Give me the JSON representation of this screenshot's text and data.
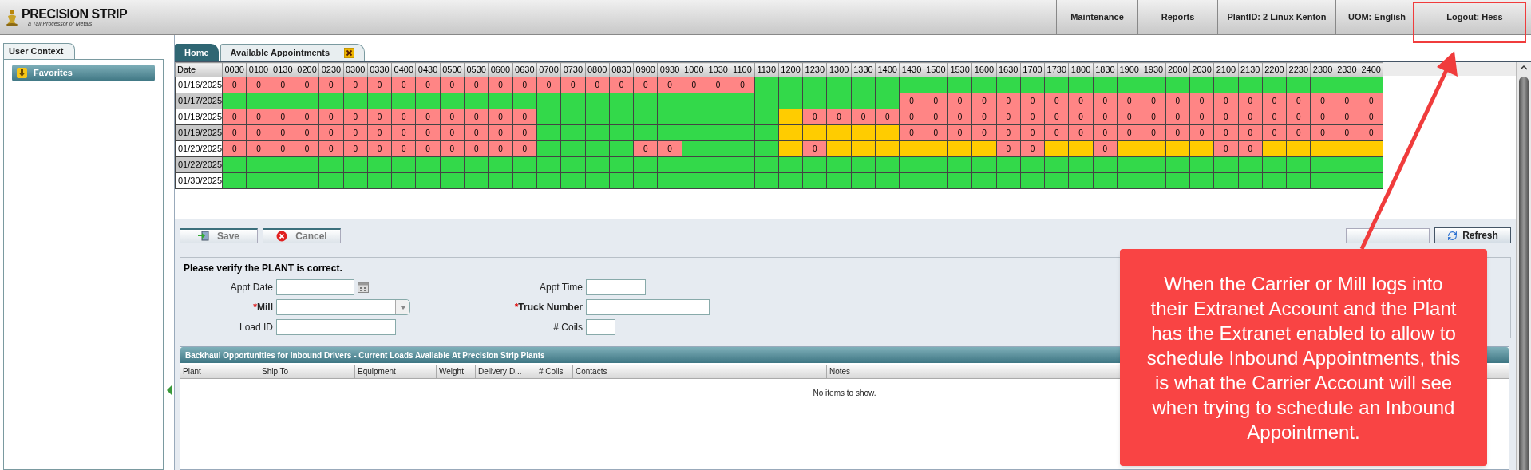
{
  "header": {
    "logo": {
      "title": "PRECISION STRIP",
      "tagline": "a Tall Processor of Metals"
    },
    "menu": [
      {
        "label": "Maintenance"
      },
      {
        "label": "Reports"
      },
      {
        "label": "PlantID: 2 Linux Kenton"
      },
      {
        "label": "UOM: English"
      },
      {
        "label": "Logout: Hess"
      }
    ]
  },
  "sidebar": {
    "tab": "User Context",
    "favorites": "Favorites"
  },
  "tabs": [
    {
      "label": "Home",
      "selected": false,
      "closable": false
    },
    {
      "label": "Available Appointments",
      "selected": true,
      "closable": true
    }
  ],
  "grid": {
    "date_header": "Date",
    "times": [
      "0030",
      "0100",
      "0130",
      "0200",
      "0230",
      "0300",
      "0330",
      "0400",
      "0430",
      "0500",
      "0530",
      "0600",
      "0630",
      "0700",
      "0730",
      "0800",
      "0830",
      "0900",
      "0930",
      "1000",
      "1030",
      "1100",
      "1130",
      "1200",
      "1230",
      "1300",
      "1330",
      "1400",
      "1430",
      "1500",
      "1530",
      "1600",
      "1630",
      "1700",
      "1730",
      "1800",
      "1830",
      "1900",
      "1930",
      "2000",
      "2030",
      "2100",
      "2130",
      "2200",
      "2230",
      "2300",
      "2330",
      "2400"
    ],
    "rows": [
      {
        "date": "01/16/2025",
        "slots": [
          {
            "color": "#ff8585",
            "count": "0"
          },
          {
            "color": "#ff8585",
            "count": "0"
          },
          {
            "color": "#ff8585",
            "count": "0"
          },
          {
            "color": "#ff8585",
            "count": "0"
          },
          {
            "color": "#ff8585",
            "count": "0"
          },
          {
            "color": "#ff8585",
            "count": "0"
          },
          {
            "color": "#ff8585",
            "count": "0"
          },
          {
            "color": "#ff8585",
            "count": "0"
          },
          {
            "color": "#ff8585",
            "count": "0"
          },
          {
            "color": "#ff8585",
            "count": "0"
          },
          {
            "color": "#ff8585",
            "count": "0"
          },
          {
            "color": "#ff8585",
            "count": "0"
          },
          {
            "color": "#ff8585",
            "count": "0"
          },
          {
            "color": "#ff8585",
            "count": "0"
          },
          {
            "color": "#ff8585",
            "count": "0"
          },
          {
            "color": "#ff8585",
            "count": "0"
          },
          {
            "color": "#ff8585",
            "count": "0"
          },
          {
            "color": "#ff8585",
            "count": "0"
          },
          {
            "color": "#ff8585",
            "count": "0"
          },
          {
            "color": "#ff8585",
            "count": "0"
          },
          {
            "color": "#ff8585",
            "count": "0"
          },
          {
            "color": "#ff8585",
            "count": "0"
          },
          {
            "color": "#33d94a"
          },
          {
            "color": "#33d94a"
          },
          {
            "color": "#33d94a"
          },
          {
            "color": "#33d94a"
          },
          {
            "color": "#33d94a"
          },
          {
            "color": "#33d94a"
          },
          {
            "color": "#33d94a"
          },
          {
            "color": "#33d94a"
          },
          {
            "color": "#33d94a"
          },
          {
            "color": "#33d94a"
          },
          {
            "color": "#33d94a"
          },
          {
            "color": "#33d94a"
          },
          {
            "color": "#33d94a"
          },
          {
            "color": "#33d94a"
          },
          {
            "color": "#33d94a"
          },
          {
            "color": "#33d94a"
          },
          {
            "color": "#33d94a"
          },
          {
            "color": "#33d94a"
          },
          {
            "color": "#33d94a"
          },
          {
            "color": "#33d94a"
          },
          {
            "color": "#33d94a"
          },
          {
            "color": "#33d94a"
          },
          {
            "color": "#33d94a"
          },
          {
            "color": "#33d94a"
          },
          {
            "color": "#33d94a"
          },
          {
            "color": "#33d94a"
          }
        ]
      },
      {
        "date": "01/17/2025",
        "slots": [
          {
            "color": "#33d94a"
          },
          {
            "color": "#33d94a"
          },
          {
            "color": "#33d94a"
          },
          {
            "color": "#33d94a"
          },
          {
            "color": "#33d94a"
          },
          {
            "color": "#33d94a"
          },
          {
            "color": "#33d94a"
          },
          {
            "color": "#33d94a"
          },
          {
            "color": "#33d94a"
          },
          {
            "color": "#33d94a"
          },
          {
            "color": "#33d94a"
          },
          {
            "color": "#33d94a"
          },
          {
            "color": "#33d94a"
          },
          {
            "color": "#33d94a"
          },
          {
            "color": "#33d94a"
          },
          {
            "color": "#33d94a"
          },
          {
            "color": "#33d94a"
          },
          {
            "color": "#33d94a"
          },
          {
            "color": "#33d94a"
          },
          {
            "color": "#33d94a"
          },
          {
            "color": "#33d94a"
          },
          {
            "color": "#33d94a"
          },
          {
            "color": "#33d94a"
          },
          {
            "color": "#33d94a"
          },
          {
            "color": "#33d94a"
          },
          {
            "color": "#33d94a"
          },
          {
            "color": "#33d94a"
          },
          {
            "color": "#33d94a"
          },
          {
            "color": "#ff8585",
            "count": "0"
          },
          {
            "color": "#ff8585",
            "count": "0"
          },
          {
            "color": "#ff8585",
            "count": "0"
          },
          {
            "color": "#ff8585",
            "count": "0"
          },
          {
            "color": "#ff8585",
            "count": "0"
          },
          {
            "color": "#ff8585",
            "count": "0"
          },
          {
            "color": "#ff8585",
            "count": "0"
          },
          {
            "color": "#ff8585",
            "count": "0"
          },
          {
            "color": "#ff8585",
            "count": "0"
          },
          {
            "color": "#ff8585",
            "count": "0"
          },
          {
            "color": "#ff8585",
            "count": "0"
          },
          {
            "color": "#ff8585",
            "count": "0"
          },
          {
            "color": "#ff8585",
            "count": "0"
          },
          {
            "color": "#ff8585",
            "count": "0"
          },
          {
            "color": "#ff8585",
            "count": "0"
          },
          {
            "color": "#ff8585",
            "count": "0"
          },
          {
            "color": "#ff8585",
            "count": "0"
          },
          {
            "color": "#ff8585",
            "count": "0"
          },
          {
            "color": "#ff8585",
            "count": "0"
          },
          {
            "color": "#ff8585",
            "count": "0"
          }
        ]
      },
      {
        "date": "01/18/2025",
        "slots": [
          {
            "color": "#ff8585",
            "count": "0"
          },
          {
            "color": "#ff8585",
            "count": "0"
          },
          {
            "color": "#ff8585",
            "count": "0"
          },
          {
            "color": "#ff8585",
            "count": "0"
          },
          {
            "color": "#ff8585",
            "count": "0"
          },
          {
            "color": "#ff8585",
            "count": "0"
          },
          {
            "color": "#ff8585",
            "count": "0"
          },
          {
            "color": "#ff8585",
            "count": "0"
          },
          {
            "color": "#ff8585",
            "count": "0"
          },
          {
            "color": "#ff8585",
            "count": "0"
          },
          {
            "color": "#ff8585",
            "count": "0"
          },
          {
            "color": "#ff8585",
            "count": "0"
          },
          {
            "color": "#ff8585",
            "count": "0"
          },
          {
            "color": "#33d94a"
          },
          {
            "color": "#33d94a"
          },
          {
            "color": "#33d94a"
          },
          {
            "color": "#33d94a"
          },
          {
            "color": "#33d94a"
          },
          {
            "color": "#33d94a"
          },
          {
            "color": "#33d94a"
          },
          {
            "color": "#33d94a"
          },
          {
            "color": "#33d94a"
          },
          {
            "color": "#33d94a"
          },
          {
            "color": "#ffcc00"
          },
          {
            "color": "#ff8585",
            "count": "0"
          },
          {
            "color": "#ff8585",
            "count": "0"
          },
          {
            "color": "#ff8585",
            "count": "0"
          },
          {
            "color": "#ff8585",
            "count": "0"
          },
          {
            "color": "#ff8585",
            "count": "0"
          },
          {
            "color": "#ff8585",
            "count": "0"
          },
          {
            "color": "#ff8585",
            "count": "0"
          },
          {
            "color": "#ff8585",
            "count": "0"
          },
          {
            "color": "#ff8585",
            "count": "0"
          },
          {
            "color": "#ff8585",
            "count": "0"
          },
          {
            "color": "#ff8585",
            "count": "0"
          },
          {
            "color": "#ff8585",
            "count": "0"
          },
          {
            "color": "#ff8585",
            "count": "0"
          },
          {
            "color": "#ff8585",
            "count": "0"
          },
          {
            "color": "#ff8585",
            "count": "0"
          },
          {
            "color": "#ff8585",
            "count": "0"
          },
          {
            "color": "#ff8585",
            "count": "0"
          },
          {
            "color": "#ff8585",
            "count": "0"
          },
          {
            "color": "#ff8585",
            "count": "0"
          },
          {
            "color": "#ff8585",
            "count": "0"
          },
          {
            "color": "#ff8585",
            "count": "0"
          },
          {
            "color": "#ff8585",
            "count": "0"
          },
          {
            "color": "#ff8585",
            "count": "0"
          },
          {
            "color": "#ff8585",
            "count": "0"
          }
        ]
      },
      {
        "date": "01/19/2025",
        "slots": [
          {
            "color": "#ff8585",
            "count": "0"
          },
          {
            "color": "#ff8585",
            "count": "0"
          },
          {
            "color": "#ff8585",
            "count": "0"
          },
          {
            "color": "#ff8585",
            "count": "0"
          },
          {
            "color": "#ff8585",
            "count": "0"
          },
          {
            "color": "#ff8585",
            "count": "0"
          },
          {
            "color": "#ff8585",
            "count": "0"
          },
          {
            "color": "#ff8585",
            "count": "0"
          },
          {
            "color": "#ff8585",
            "count": "0"
          },
          {
            "color": "#ff8585",
            "count": "0"
          },
          {
            "color": "#ff8585",
            "count": "0"
          },
          {
            "color": "#ff8585",
            "count": "0"
          },
          {
            "color": "#ff8585",
            "count": "0"
          },
          {
            "color": "#33d94a"
          },
          {
            "color": "#33d94a"
          },
          {
            "color": "#33d94a"
          },
          {
            "color": "#33d94a"
          },
          {
            "color": "#33d94a"
          },
          {
            "color": "#33d94a"
          },
          {
            "color": "#33d94a"
          },
          {
            "color": "#33d94a"
          },
          {
            "color": "#33d94a"
          },
          {
            "color": "#33d94a"
          },
          {
            "color": "#ffcc00"
          },
          {
            "color": "#ffcc00"
          },
          {
            "color": "#ffcc00"
          },
          {
            "color": "#ffcc00"
          },
          {
            "color": "#ffcc00"
          },
          {
            "color": "#ff8585",
            "count": "0"
          },
          {
            "color": "#ff8585",
            "count": "0"
          },
          {
            "color": "#ff8585",
            "count": "0"
          },
          {
            "color": "#ff8585",
            "count": "0"
          },
          {
            "color": "#ff8585",
            "count": "0"
          },
          {
            "color": "#ff8585",
            "count": "0"
          },
          {
            "color": "#ff8585",
            "count": "0"
          },
          {
            "color": "#ff8585",
            "count": "0"
          },
          {
            "color": "#ff8585",
            "count": "0"
          },
          {
            "color": "#ff8585",
            "count": "0"
          },
          {
            "color": "#ff8585",
            "count": "0"
          },
          {
            "color": "#ff8585",
            "count": "0"
          },
          {
            "color": "#ff8585",
            "count": "0"
          },
          {
            "color": "#ff8585",
            "count": "0"
          },
          {
            "color": "#ff8585",
            "count": "0"
          },
          {
            "color": "#ff8585",
            "count": "0"
          },
          {
            "color": "#ff8585",
            "count": "0"
          },
          {
            "color": "#ff8585",
            "count": "0"
          },
          {
            "color": "#ff8585",
            "count": "0"
          },
          {
            "color": "#ff8585",
            "count": "0"
          }
        ]
      },
      {
        "date": "01/20/2025",
        "slots": [
          {
            "color": "#ff8585",
            "count": "0"
          },
          {
            "color": "#ff8585",
            "count": "0"
          },
          {
            "color": "#ff8585",
            "count": "0"
          },
          {
            "color": "#ff8585",
            "count": "0"
          },
          {
            "color": "#ff8585",
            "count": "0"
          },
          {
            "color": "#ff8585",
            "count": "0"
          },
          {
            "color": "#ff8585",
            "count": "0"
          },
          {
            "color": "#ff8585",
            "count": "0"
          },
          {
            "color": "#ff8585",
            "count": "0"
          },
          {
            "color": "#ff8585",
            "count": "0"
          },
          {
            "color": "#ff8585",
            "count": "0"
          },
          {
            "color": "#ff8585",
            "count": "0"
          },
          {
            "color": "#ff8585",
            "count": "0"
          },
          {
            "color": "#33d94a"
          },
          {
            "color": "#33d94a"
          },
          {
            "color": "#33d94a"
          },
          {
            "color": "#33d94a"
          },
          {
            "color": "#ff8585",
            "count": "0"
          },
          {
            "color": "#ff8585",
            "count": "0"
          },
          {
            "color": "#33d94a"
          },
          {
            "color": "#33d94a"
          },
          {
            "color": "#33d94a"
          },
          {
            "color": "#33d94a"
          },
          {
            "color": "#ffcc00"
          },
          {
            "color": "#ff8585",
            "count": "0"
          },
          {
            "color": "#ffcc00"
          },
          {
            "color": "#ffcc00"
          },
          {
            "color": "#ffcc00"
          },
          {
            "color": "#ffcc00"
          },
          {
            "color": "#ffcc00"
          },
          {
            "color": "#ffcc00"
          },
          {
            "color": "#ffcc00"
          },
          {
            "color": "#ff8585",
            "count": "0"
          },
          {
            "color": "#ff8585",
            "count": "0"
          },
          {
            "color": "#ffcc00"
          },
          {
            "color": "#ffcc00"
          },
          {
            "color": "#ff8585",
            "count": "0"
          },
          {
            "color": "#ffcc00"
          },
          {
            "color": "#ffcc00"
          },
          {
            "color": "#ffcc00"
          },
          {
            "color": "#ffcc00"
          },
          {
            "color": "#ff8585",
            "count": "0"
          },
          {
            "color": "#ff8585",
            "count": "0"
          },
          {
            "color": "#ffcc00"
          },
          {
            "color": "#ffcc00"
          },
          {
            "color": "#ffcc00"
          },
          {
            "color": "#ffcc00"
          },
          {
            "color": "#ffcc00"
          }
        ]
      },
      {
        "date": "01/22/2025",
        "slots": [
          {
            "color": "#33d94a"
          },
          {
            "color": "#33d94a"
          },
          {
            "color": "#33d94a"
          },
          {
            "color": "#33d94a"
          },
          {
            "color": "#33d94a"
          },
          {
            "color": "#33d94a"
          },
          {
            "color": "#33d94a"
          },
          {
            "color": "#33d94a"
          },
          {
            "color": "#33d94a"
          },
          {
            "color": "#33d94a"
          },
          {
            "color": "#33d94a"
          },
          {
            "color": "#33d94a"
          },
          {
            "color": "#33d94a"
          },
          {
            "color": "#33d94a"
          },
          {
            "color": "#33d94a"
          },
          {
            "color": "#33d94a"
          },
          {
            "color": "#33d94a"
          },
          {
            "color": "#33d94a"
          },
          {
            "color": "#33d94a"
          },
          {
            "color": "#33d94a"
          },
          {
            "color": "#33d94a"
          },
          {
            "color": "#33d94a"
          },
          {
            "color": "#33d94a"
          },
          {
            "color": "#33d94a"
          },
          {
            "color": "#33d94a"
          },
          {
            "color": "#33d94a"
          },
          {
            "color": "#33d94a"
          },
          {
            "color": "#33d94a"
          },
          {
            "color": "#33d94a"
          },
          {
            "color": "#33d94a"
          },
          {
            "color": "#33d94a"
          },
          {
            "color": "#33d94a"
          },
          {
            "color": "#33d94a"
          },
          {
            "color": "#33d94a"
          },
          {
            "color": "#33d94a"
          },
          {
            "color": "#33d94a"
          },
          {
            "color": "#33d94a"
          },
          {
            "color": "#33d94a"
          },
          {
            "color": "#33d94a"
          },
          {
            "color": "#33d94a"
          },
          {
            "color": "#33d94a"
          },
          {
            "color": "#33d94a"
          },
          {
            "color": "#33d94a"
          },
          {
            "color": "#33d94a"
          },
          {
            "color": "#33d94a"
          },
          {
            "color": "#33d94a"
          },
          {
            "color": "#33d94a"
          },
          {
            "color": "#33d94a"
          }
        ]
      },
      {
        "date": "01/30/2025",
        "slots": [
          {
            "color": "#33d94a"
          },
          {
            "color": "#33d94a"
          },
          {
            "color": "#33d94a"
          },
          {
            "color": "#33d94a"
          },
          {
            "color": "#33d94a"
          },
          {
            "color": "#33d94a"
          },
          {
            "color": "#33d94a"
          },
          {
            "color": "#33d94a"
          },
          {
            "color": "#33d94a"
          },
          {
            "color": "#33d94a"
          },
          {
            "color": "#33d94a"
          },
          {
            "color": "#33d94a"
          },
          {
            "color": "#33d94a"
          },
          {
            "color": "#33d94a"
          },
          {
            "color": "#33d94a"
          },
          {
            "color": "#33d94a"
          },
          {
            "color": "#33d94a"
          },
          {
            "color": "#33d94a"
          },
          {
            "color": "#33d94a"
          },
          {
            "color": "#33d94a"
          },
          {
            "color": "#33d94a"
          },
          {
            "color": "#33d94a"
          },
          {
            "color": "#33d94a"
          },
          {
            "color": "#33d94a"
          },
          {
            "color": "#33d94a"
          },
          {
            "color": "#33d94a"
          },
          {
            "color": "#33d94a"
          },
          {
            "color": "#33d94a"
          },
          {
            "color": "#33d94a"
          },
          {
            "color": "#33d94a"
          },
          {
            "color": "#33d94a"
          },
          {
            "color": "#33d94a"
          },
          {
            "color": "#33d94a"
          },
          {
            "color": "#33d94a"
          },
          {
            "color": "#33d94a"
          },
          {
            "color": "#33d94a"
          },
          {
            "color": "#33d94a"
          },
          {
            "color": "#33d94a"
          },
          {
            "color": "#33d94a"
          },
          {
            "color": "#33d94a"
          },
          {
            "color": "#33d94a"
          },
          {
            "color": "#33d94a"
          },
          {
            "color": "#33d94a"
          },
          {
            "color": "#33d94a"
          },
          {
            "color": "#33d94a"
          },
          {
            "color": "#33d94a"
          },
          {
            "color": "#33d94a"
          },
          {
            "color": "#33d94a"
          }
        ]
      }
    ]
  },
  "toolbar": {
    "buttons": [
      {
        "label": "Save",
        "kind": "save"
      },
      {
        "label": "Cancel",
        "kind": "cancel"
      }
    ],
    "refresh": "Refresh"
  },
  "form": {
    "notice": "Please verify the PLANT is correct.",
    "fields": [
      {
        "label": "Appt Date",
        "kind": "date"
      },
      {
        "label": "Appt Time",
        "kind": "text"
      },
      {
        "label": "Mill",
        "required_mark": "*",
        "kind": "select"
      },
      {
        "label": "Truck Number",
        "required_mark": "*",
        "kind": "text"
      },
      {
        "label": "Load ID",
        "kind": "text"
      },
      {
        "label": "# Coils",
        "kind": "text"
      }
    ]
  },
  "backhaul": {
    "title": "Backhaul Opportunities for Inbound Drivers - Current Loads Available At Precision Strip Plants",
    "columns": [
      "Plant",
      "Ship To",
      "Equipment",
      "Weight",
      "Delivery D...",
      "# Coils",
      "Contacts",
      "Notes"
    ],
    "empty": "No items to show."
  },
  "annotation": {
    "text": "When the Carrier or Mill logs into their Extranet Account and the Plant has the Extranet enabled to allow to schedule Inbound Appointments, this is what the Carrier Account will see when trying to schedule an Inbound Appointment."
  }
}
